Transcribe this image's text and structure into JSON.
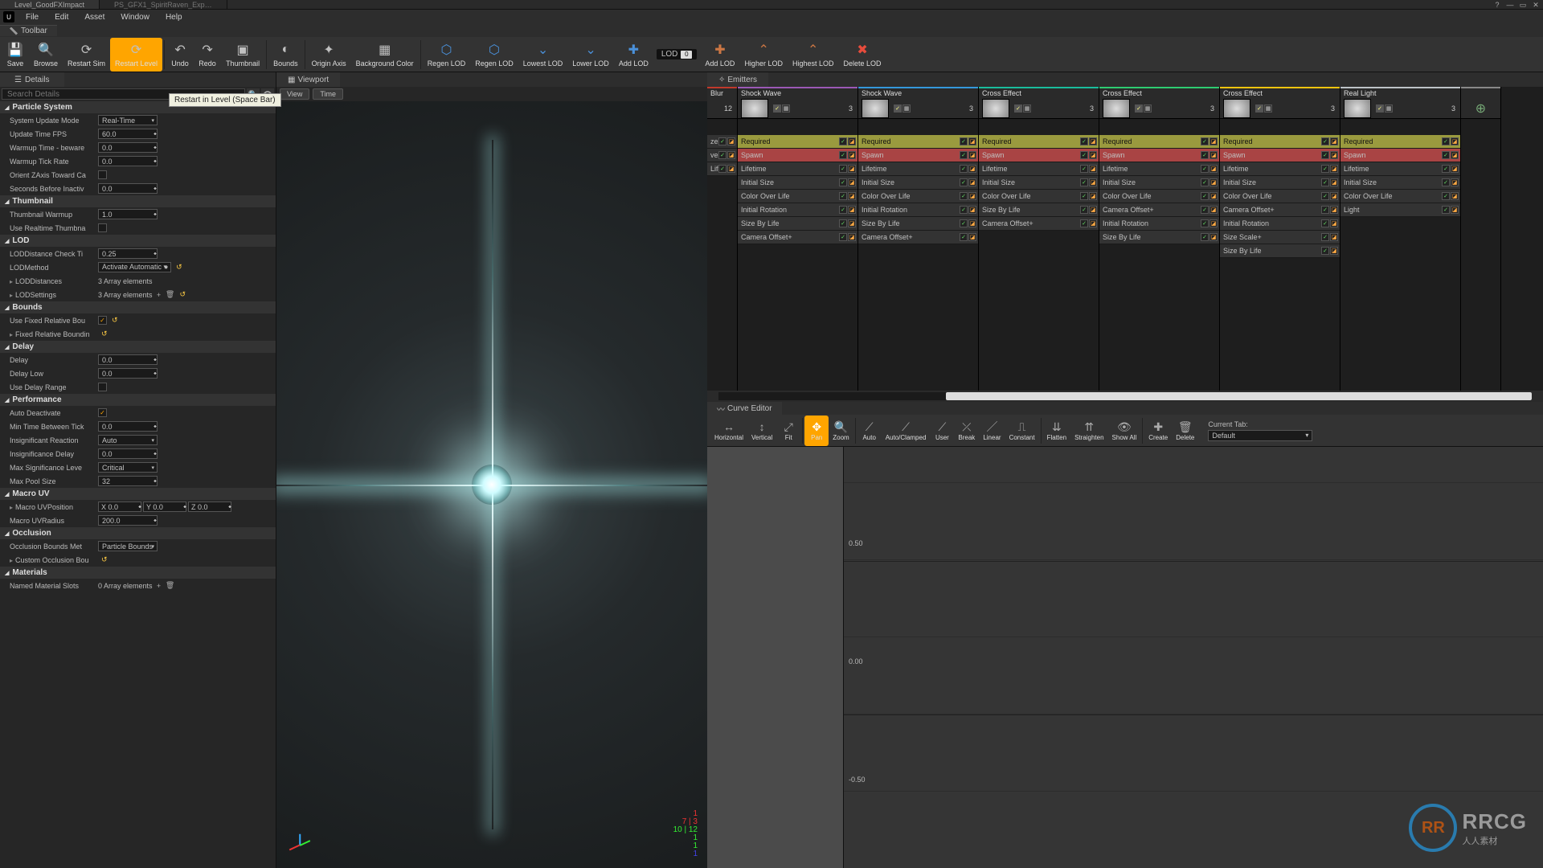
{
  "tabs": {
    "a": "Level_GoodFXImpact",
    "b": "PS_GFX1_SpiritRaven_Exp…"
  },
  "menu": {
    "file": "File",
    "edit": "Edit",
    "asset": "Asset",
    "window": "Window",
    "help": "Help"
  },
  "toolbar_tab": "Toolbar",
  "toolbar": {
    "save": "Save",
    "browse": "Browse",
    "restartsim": "Restart Sim",
    "restartlvl": "Restart Level",
    "undo": "Undo",
    "redo": "Redo",
    "thumbnail": "Thumbnail",
    "bounds": "Bounds",
    "originaxis": "Origin Axis",
    "bgcolor": "Background Color",
    "regenlod": "Regen LOD",
    "regenlod2": "Regen LOD",
    "lowestlod": "Lowest LOD",
    "lowerlod": "Lower LOD",
    "addlod": "Add LOD",
    "lod": "LOD",
    "lodn": "0",
    "addlod2": "Add LOD",
    "higherlod": "Higher LOD",
    "highestlod": "Highest LOD",
    "deletelod": "Delete LOD"
  },
  "tooltip": "Restart in Level (Space Bar)",
  "details_tab": "Details",
  "search_placeholder": "Search Details",
  "sections": {
    "particle": {
      "title": "Particle System",
      "update_mode_l": "System Update Mode",
      "update_mode_v": "Real-Time",
      "fps_l": "Update Time FPS",
      "fps_v": "60.0",
      "warmup_l": "Warmup Time - beware",
      "warmup_v": "0.0",
      "warmtick_l": "Warmup Tick Rate",
      "warmtick_v": "0.0",
      "orient_l": "Orient ZAxis Toward Ca",
      "seconds_l": "Seconds Before Inactiv",
      "seconds_v": "0.0"
    },
    "thumbnail": {
      "title": "Thumbnail",
      "warm_l": "Thumbnail Warmup",
      "warm_v": "1.0",
      "rt_l": "Use Realtime Thumbna"
    },
    "lod": {
      "title": "LOD",
      "check_l": "LODDistance Check Ti",
      "check_v": "0.25",
      "method_l": "LODMethod",
      "method_v": "Activate Automatic ▾",
      "dist_l": "LODDistances",
      "dist_v": "3 Array elements",
      "set_l": "LODSettings",
      "set_v": "3 Array elements"
    },
    "bounds": {
      "title": "Bounds",
      "ufr_l": "Use Fixed Relative Bou",
      "frb_l": "Fixed Relative Boundin"
    },
    "delay": {
      "title": "Delay",
      "d_l": "Delay",
      "d_v": "0.0",
      "dl_l": "Delay Low",
      "dl_v": "0.0",
      "udr_l": "Use Delay Range"
    },
    "perf": {
      "title": "Performance",
      "ad_l": "Auto Deactivate",
      "mtb_l": "Min Time Between Tick",
      "mtb_v": "0.0",
      "ir_l": "Insignificant Reaction",
      "ir_v": "Auto",
      "id_l": "Insignificance Delay",
      "id_v": "0.0",
      "msl_l": "Max Significance Leve",
      "msl_v": "Critical",
      "mps_l": "Max Pool Size",
      "mps_v": "32"
    },
    "macro": {
      "title": "Macro UV",
      "pos_l": "Macro UVPosition",
      "x": "X  0.0",
      "y": "Y  0.0",
      "z": "Z  0.0",
      "rad_l": "Macro UVRadius",
      "rad_v": "200.0"
    },
    "occ": {
      "title": "Occlusion",
      "obm_l": "Occlusion Bounds Met",
      "obm_v": "Particle Bounds",
      "cob_l": "Custom Occlusion Bou"
    },
    "mat": {
      "title": "Materials",
      "nms_l": "Named Material Slots",
      "nms_v": "0 Array elements"
    }
  },
  "viewport_tab": "Viewport",
  "view_btn": "View",
  "time_btn": "Time",
  "emitters_tab": "Emitters",
  "emitters": [
    {
      "name": "Blur",
      "count": "12",
      "color": "#c0392b",
      "mods": [
        "ze",
        "ver Life",
        "Life"
      ]
    },
    {
      "name": "Shock Wave",
      "count": "3",
      "color": "#9b59b6",
      "mods": [
        "Required",
        "Spawn",
        "Lifetime",
        "Initial Size",
        "Color Over Life",
        "Initial Rotation",
        "Size By Life",
        "Camera Offset+"
      ]
    },
    {
      "name": "Shock Wave",
      "count": "3",
      "color": "#3498db",
      "mods": [
        "Required",
        "Spawn",
        "Lifetime",
        "Initial Size",
        "Color Over Life",
        "Initial Rotation",
        "Size By Life",
        "Camera Offset+"
      ]
    },
    {
      "name": "Cross Effect",
      "count": "3",
      "color": "#1abc9c",
      "mods": [
        "Required",
        "Spawn",
        "Lifetime",
        "Initial Size",
        "Color Over Life",
        "Size By Life",
        "Camera Offset+"
      ]
    },
    {
      "name": "Cross Effect",
      "count": "3",
      "color": "#2ecc71",
      "mods": [
        "Required",
        "Spawn",
        "Lifetime",
        "Initial Size",
        "Color Over Life",
        "Camera Offset+",
        "Initial Rotation",
        "Size By Life"
      ]
    },
    {
      "name": "Cross Effect",
      "count": "3",
      "color": "#f1c40f",
      "mods": [
        "Required",
        "Spawn",
        "Lifetime",
        "Initial Size",
        "Color Over Life",
        "Camera Offset+",
        "Initial Rotation",
        "Size Scale+",
        "Size By Life"
      ]
    },
    {
      "name": "Real Light",
      "count": "3",
      "color": "#bdc3c7",
      "mods": [
        "Required",
        "Spawn",
        "Lifetime",
        "Initial Size",
        "Color Over Life",
        "Light"
      ]
    }
  ],
  "curve_tab": "Curve Editor",
  "curve_buttons": {
    "h": "Horizontal",
    "v": "Vertical",
    "fit": "Fit",
    "pan": "Pan",
    "zoom": "Zoom",
    "auto": "Auto",
    "ac": "Auto/Clamped",
    "user": "User",
    "break": "Break",
    "linear": "Linear",
    "const": "Constant",
    "flat": "Flatten",
    "str": "Straighten",
    "all": "Show All",
    "create": "Create",
    "del": "Delete"
  },
  "curve_right": {
    "label": "Current Tab:",
    "value": "Default"
  },
  "curve_axis": {
    "a": "0.50",
    "b": "0.00",
    "c": "-0.50"
  },
  "watermark": {
    "logo": "RR",
    "big": "RRCG",
    "small": "人人素材"
  }
}
